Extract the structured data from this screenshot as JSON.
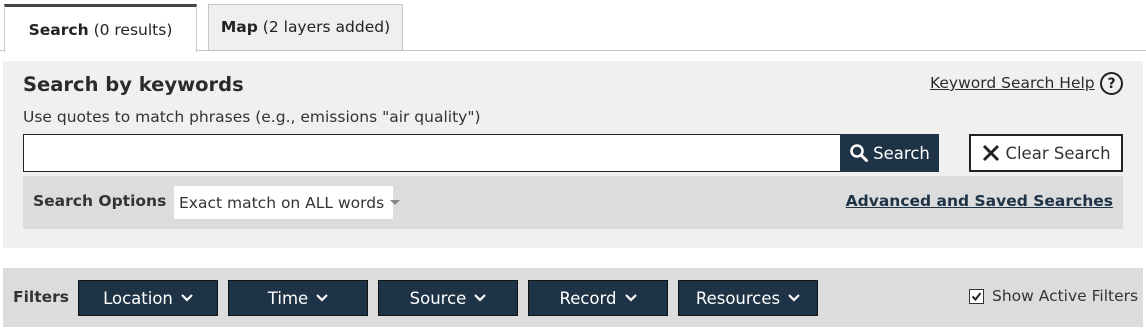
{
  "tabs": {
    "search": {
      "bold": "Search",
      "count": "(0 results)"
    },
    "map": {
      "bold": "Map",
      "count": "(2 layers added)"
    }
  },
  "keyword_panel": {
    "title": "Search by keywords",
    "help_link": "Keyword Search Help",
    "help_icon": "?",
    "hint": "Use quotes to match phrases (e.g., emissions \"air quality\")",
    "input_value": "",
    "search_button": "Search",
    "clear_button": "Clear Search"
  },
  "search_options": {
    "label": "Search Options",
    "selected": "Exact match on ALL words",
    "advanced_link": "Advanced and Saved Searches"
  },
  "filters": {
    "label": "Filters",
    "buttons": [
      "Location",
      "Time",
      "Source",
      "Record",
      "Resources"
    ],
    "show_active_label": "Show Active Filters",
    "show_active_checked": true
  },
  "colors": {
    "primary_dark": "#1f3347",
    "panel_bg": "#f0f0f0",
    "bar_bg": "#dcdcdc"
  }
}
